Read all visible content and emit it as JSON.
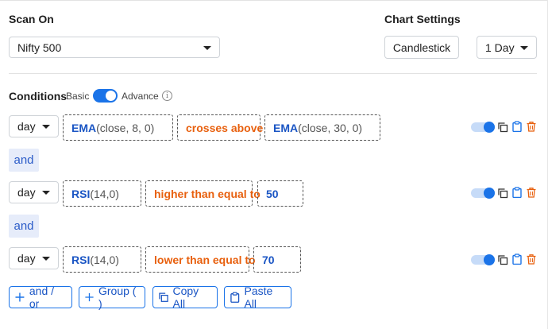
{
  "scan": {
    "label": "Scan On",
    "universe": "Nifty 500"
  },
  "chart_settings": {
    "label": "Chart Settings",
    "type_button": "Candlestick",
    "timeframe": "1 Day"
  },
  "conditions": {
    "label": "Conditions",
    "mode_basic": "Basic",
    "mode_advance": "Advance",
    "mode_advanced_enabled": true,
    "info_glyph": "i",
    "rows": [
      {
        "timeframe": "day",
        "lhs_fn": "EMA",
        "lhs_args": "(close, 8, 0)",
        "operator": "crosses above",
        "rhs_fn": "EMA",
        "rhs_args": "(close, 30, 0)",
        "enabled": true
      },
      {
        "timeframe": "day",
        "lhs_fn": "RSI",
        "lhs_args": "(14,0)",
        "operator": "higher than equal to",
        "rhs_value": "50",
        "enabled": true
      },
      {
        "timeframe": "day",
        "lhs_fn": "RSI",
        "lhs_args": "(14,0)",
        "operator": "lower than equal to",
        "rhs_value": "70",
        "enabled": true
      }
    ],
    "joiners": [
      "and",
      "and"
    ]
  },
  "actions": {
    "and_or": "and / or",
    "group": "Group ( )",
    "copy_all": "Copy All",
    "paste_all": "Paste All"
  },
  "icons": {
    "copy": "copy-icon",
    "clipboard": "clipboard-icon",
    "delete": "trash-icon",
    "plus": "plus-icon",
    "dropdown": "chevron-down-icon"
  },
  "colors": {
    "accent": "#1a73e8",
    "function_text": "#1a55c4",
    "operator_text": "#e8600e",
    "delete_icon": "#e8600e",
    "and_chip_bg": "#e6ecfa"
  }
}
